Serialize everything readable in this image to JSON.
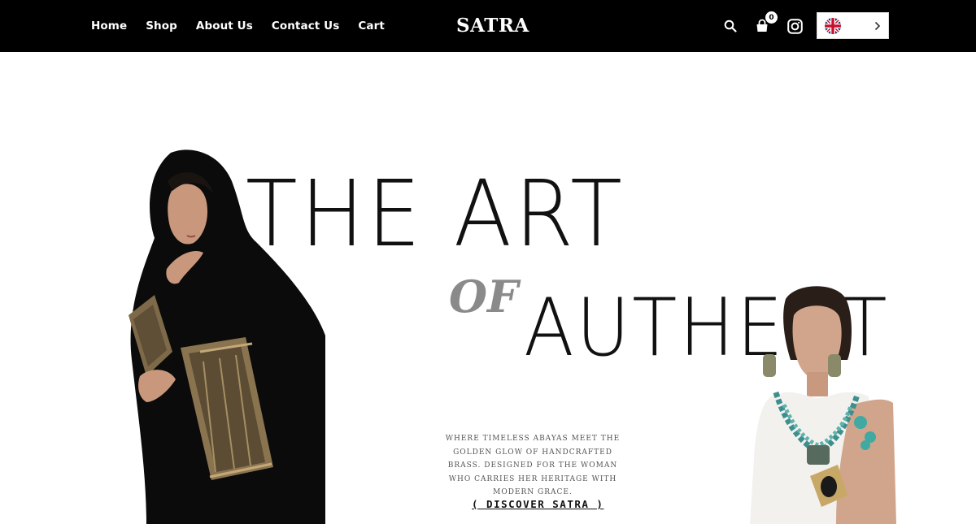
{
  "header": {
    "nav": [
      "Home",
      "Shop",
      "About Us",
      "Contact Us",
      "Cart"
    ],
    "logo": "SATRA",
    "cart_count": "0",
    "icons": [
      "search-icon",
      "cart-icon",
      "instagram-icon",
      "uk-flag-icon",
      "chevron-right-icon"
    ]
  },
  "hero": {
    "headline_1": "THE ART",
    "headline_of": "OF",
    "headline_2": "AUTHENTIC",
    "tagline": "WHERE TIMELESS ABAYAS MEET THE GOLDEN GLOW OF HANDCRAFTED BRASS. DESIGNED FOR THE WOMAN WHO CARRIES HER HERITAGE WITH MODERN GRACE.",
    "cta": "( DISCOVER SATRA )"
  },
  "colors": {
    "header_bg": "#000000",
    "page_bg": "#ffffff",
    "accent_gray": "#8a8a8a",
    "text": "#111111"
  }
}
